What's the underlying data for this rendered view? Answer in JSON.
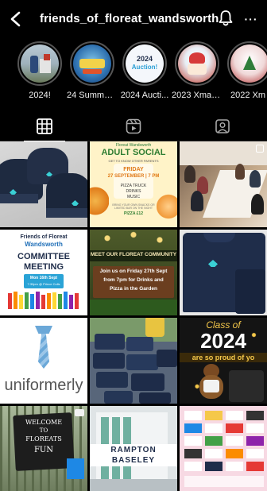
{
  "header": {
    "username": "friends_of_floreat_wandsworth",
    "back_icon": "back-arrow-icon",
    "bell_icon": "bell-icon",
    "more_label": "···"
  },
  "highlights": [
    {
      "label": "2024!"
    },
    {
      "label": "24 Summer..."
    },
    {
      "label": "2024 Aucti..."
    },
    {
      "label": "2023 Xmas..."
    },
    {
      "label": "2022 Xm"
    }
  ],
  "highlight_covers": {
    "auction_line1": "2024",
    "auction_line2": "Auction!"
  },
  "tabs": [
    {
      "name": "grid",
      "icon": "grid-icon"
    },
    {
      "name": "reels",
      "icon": "reels-icon"
    },
    {
      "name": "tagged",
      "icon": "tagged-icon"
    }
  ],
  "posts": {
    "social": {
      "brand": "Floreat Wandsworth",
      "title": "ADULT SOCIAL",
      "subtitle": "GET TO KNOW OTHER PARENTS",
      "day": "FRIDAY",
      "date": "27 SEPTEMBER | 7 PM",
      "line1": "PIZZA TRUCK",
      "line2": "DRINKS",
      "line3": "MUSIC",
      "note": "BRING YOUR OWN SNACKS OR LIMITED BAR ON THE NIGHT",
      "price": "PIZZA £12"
    },
    "committee": {
      "brand1": "Friends of Floreat",
      "brand2": "Wandsworth",
      "title1": "COMMITTEE",
      "title2": "MEETING",
      "info1": "Mon 16th Sept",
      "info2": "7:30pm @ Prince Colls"
    },
    "garden": {
      "banner": "MEET OUR FLOREAT COMMUNITY",
      "line1": "Join us on Friday 27th Sept",
      "line2": "from 7pm for Drinks and",
      "line3": "Pizza in the Garden"
    },
    "uniform": {
      "word": "uniformerly"
    },
    "class2024": {
      "line1": "Class of",
      "line2": "2024",
      "line3": "are so proud of yo"
    },
    "welcome": {
      "line1": "WELCOME",
      "line2": "TO",
      "line3": "FLOREATS",
      "line4": "FUN"
    },
    "rampton": {
      "line1": "RAMPTON",
      "line2": "BASELEY"
    }
  },
  "colors": {
    "accent_teal": "#3ad0d5",
    "navy": "#1f2d4a"
  }
}
